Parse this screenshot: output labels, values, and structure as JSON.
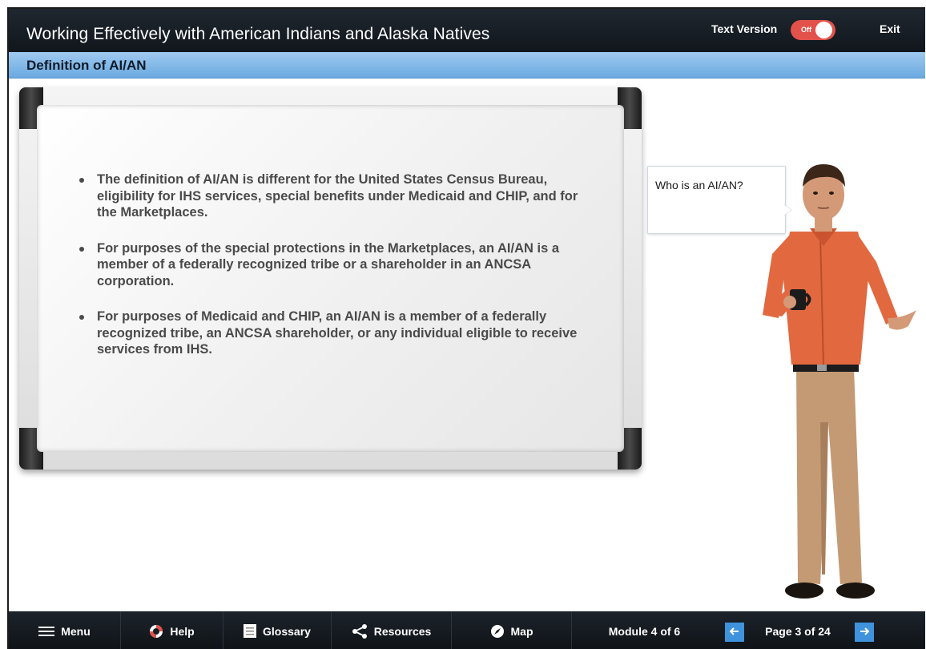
{
  "header": {
    "title": "Working Effectively with American Indians and Alaska Natives",
    "text_version_label": "Text Version",
    "text_version_state": "Off",
    "exit_label": "Exit"
  },
  "section": {
    "title": "Definition of AI/AN"
  },
  "whiteboard": {
    "bullets": [
      "The definition of AI/AN is different for the United States Census Bureau, eligibility for IHS services, special benefits under Medicaid and CHIP, and for the Marketplaces.",
      "For purposes of the special protections in the Marketplaces, an AI/AN is a member of a federally recognized tribe or a shareholder in an ANCSA corporation.",
      "For purposes of Medicaid and CHIP, an AI/AN is a member of a federally recognized tribe, an ANCSA shareholder, or any individual eligible to receive services from IHS."
    ]
  },
  "speech_bubble": {
    "text": "Who is an AI/AN?"
  },
  "nav": {
    "menu": "Menu",
    "help": "Help",
    "glossary": "Glossary",
    "resources": "Resources",
    "map": "Map",
    "module": "Module 4 of 6",
    "page": "Page 3 of 24"
  },
  "colors": {
    "header_bg": "#161c23",
    "section_bar": "#7fb7e8",
    "toggle_off": "#e2524a",
    "nav_arrow": "#3f93dd"
  },
  "icons": {
    "menu": "hamburger-icon",
    "help": "lifebuoy-icon",
    "glossary": "book-icon",
    "resources": "share-icon",
    "map": "compass-icon",
    "prev": "arrow-left-icon",
    "next": "arrow-right-icon"
  }
}
